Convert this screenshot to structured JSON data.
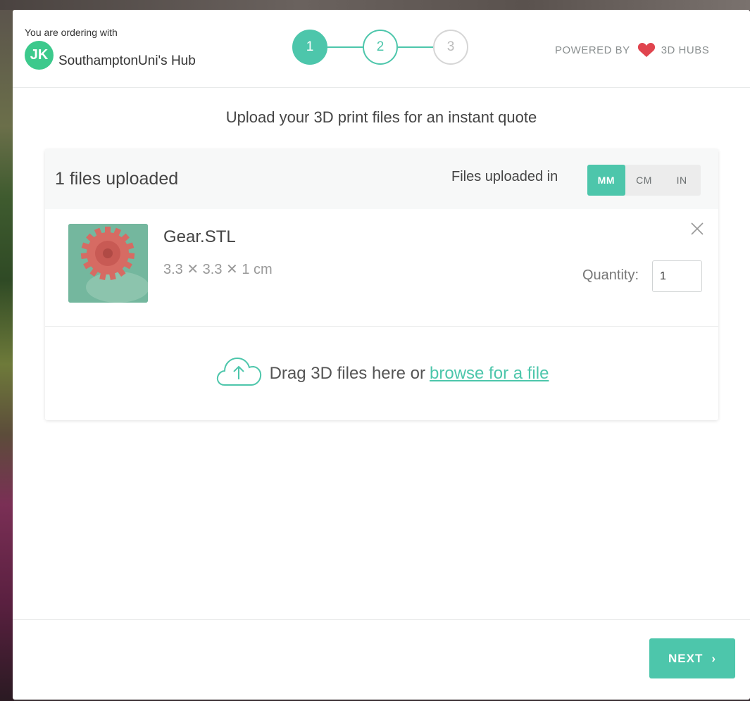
{
  "header": {
    "ordering_label": "You are ordering with",
    "avatar_initials": "JK",
    "hub_name": "SouthamptonUni's Hub",
    "steps": [
      "1",
      "2",
      "3"
    ],
    "current_step": 1,
    "powered_by": "POWERED BY",
    "brand": "3D HUBS"
  },
  "main": {
    "title": "Upload your 3D print files for an instant quote"
  },
  "card": {
    "files_count": "1 files uploaded",
    "units_label": "Files uploaded in",
    "units": [
      "MM",
      "CM",
      "IN"
    ],
    "selected_unit": "MM",
    "files": [
      {
        "name": "Gear.STL",
        "dimensions": "3.3 ✕ 3.3 ✕ 1 cm",
        "quantity_label": "Quantity:",
        "quantity": "1"
      }
    ],
    "dropzone": {
      "text": "Drag 3D files here or",
      "link": "browse for a file"
    }
  },
  "footer": {
    "next_label": "NEXT"
  },
  "colors": {
    "accent": "#4dc6ab",
    "avatar": "#3cc98c",
    "brand_red": "#e0444e"
  },
  "icons": [
    "heart-logo-icon",
    "close-icon",
    "cloud-upload-icon",
    "chevron-right-icon"
  ]
}
